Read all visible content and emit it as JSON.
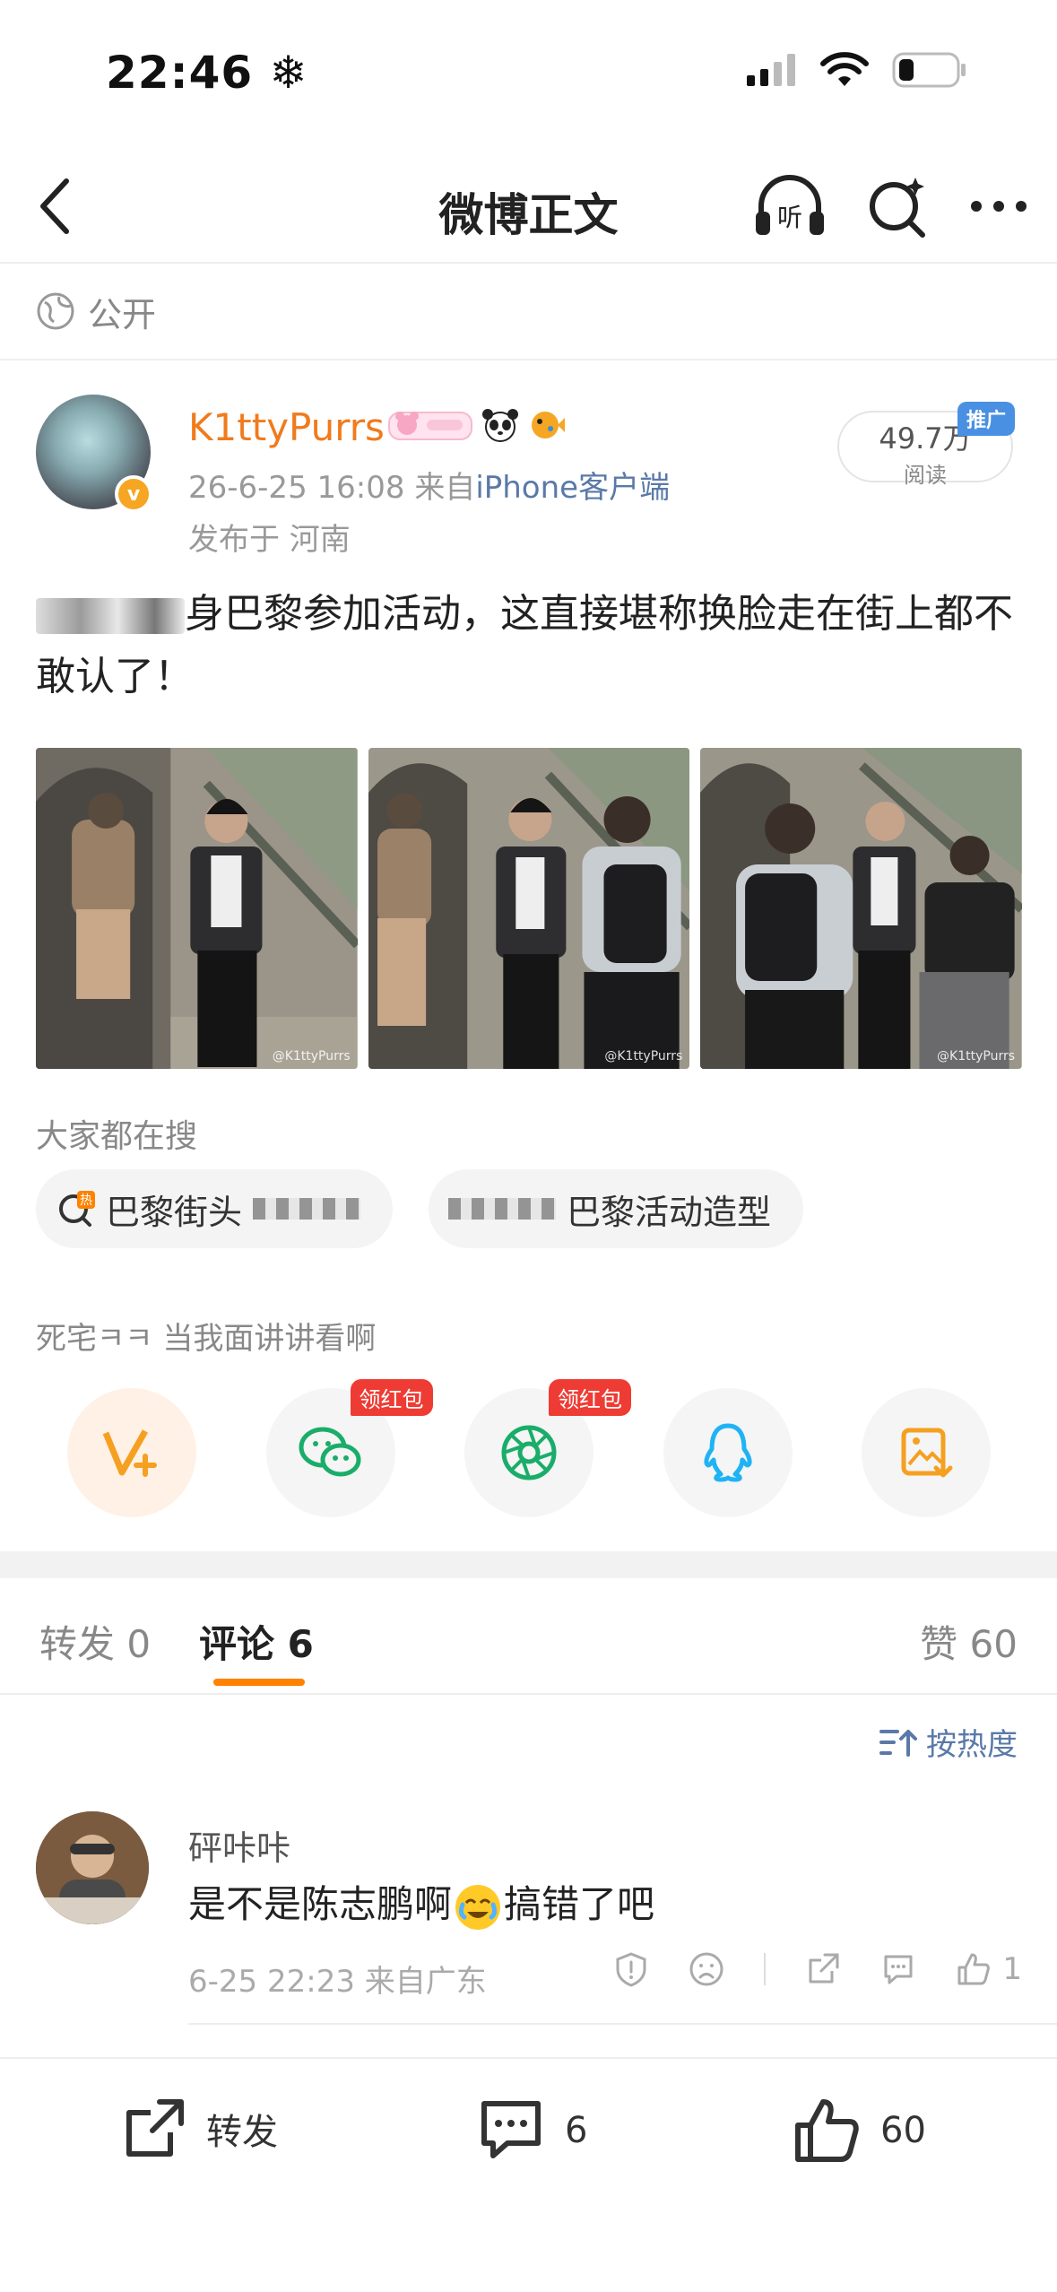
{
  "status": {
    "time": "22:46"
  },
  "nav": {
    "title": "微博正文"
  },
  "visibility": "公开",
  "post": {
    "author": "K1ttyPurrs",
    "timestamp": "26-6-25 16:08",
    "source_prefix": "来自",
    "source": "iPhone客户端",
    "location": "发布于 河南",
    "reads": "49.7万",
    "reads_label": "阅读",
    "promo_tag": "推广",
    "text_rest": "身巴黎参加活动，这直接堪称换脸走在街上都不敢认了！",
    "watermark": "@K1ttyPurrs"
  },
  "trending": {
    "label": "大家都在搜",
    "chip1": "巴黎街头",
    "chip2": "巴黎活动造型"
  },
  "share": {
    "prompt": "死宅ㅋㅋ 当我面讲讲看啊",
    "redpack": "领红包"
  },
  "tabs": {
    "repost_label": "转发",
    "repost_count": "0",
    "comment_label": "评论",
    "comment_count": "6",
    "like_label": "赞",
    "like_count": "60"
  },
  "sort": "按热度",
  "comment": {
    "name": "砰咔咔",
    "text_before": "是不是陈志鹏啊",
    "text_after": "搞错了吧",
    "meta": "6-25 22:23 来自广东",
    "likes": "1"
  },
  "bottom": {
    "repost_label": "转发",
    "comment_count": "6",
    "like_count": "60"
  }
}
